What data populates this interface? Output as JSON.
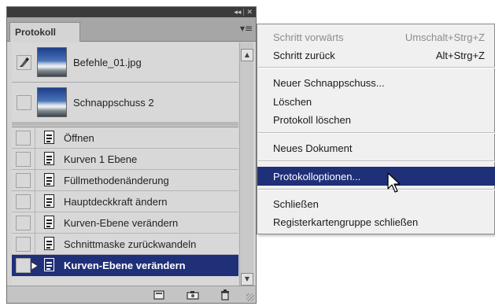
{
  "panel": {
    "collapse_buttons": {
      "collapse": "◂◂",
      "close": "✕"
    },
    "tab_label": "Protokoll",
    "menu_button": "▾≡",
    "snapshots": [
      {
        "label": "Befehle_01.jpg",
        "has_brush": true
      },
      {
        "label": "Schnappschuss 2",
        "has_brush": false
      }
    ],
    "history_items": [
      {
        "label": "Öffnen"
      },
      {
        "label": "Kurven 1 Ebene"
      },
      {
        "label": "Füllmethodenänderung"
      },
      {
        "label": "Hauptdeckkraft ändern"
      },
      {
        "label": "Kurven-Ebene verändern"
      },
      {
        "label": "Schnittmaske zurückwandeln"
      },
      {
        "label": "Kurven-Ebene verändern",
        "selected": true
      }
    ],
    "footer_buttons": [
      "new-document-from-state",
      "new-snapshot",
      "delete-state"
    ]
  },
  "menu": {
    "items": [
      {
        "label": "Schritt vorwärts",
        "shortcut": "Umschalt+Strg+Z",
        "disabled": true
      },
      {
        "label": "Schritt zurück",
        "shortcut": "Alt+Strg+Z"
      },
      {
        "label": "Neuer Schnappschuss..."
      },
      {
        "label": "Löschen"
      },
      {
        "label": "Protokoll löschen"
      },
      {
        "label": "Neues Dokument"
      },
      {
        "label": "Protokolloptionen...",
        "highlighted": true
      },
      {
        "label": "Schließen"
      },
      {
        "label": "Registerkartengruppe schließen"
      }
    ]
  },
  "colors": {
    "selection": "#1f2f78",
    "panel_bg": "#d4d4d4",
    "menu_bg": "#f0f0f0",
    "disabled_text": "#8c8c8c"
  }
}
